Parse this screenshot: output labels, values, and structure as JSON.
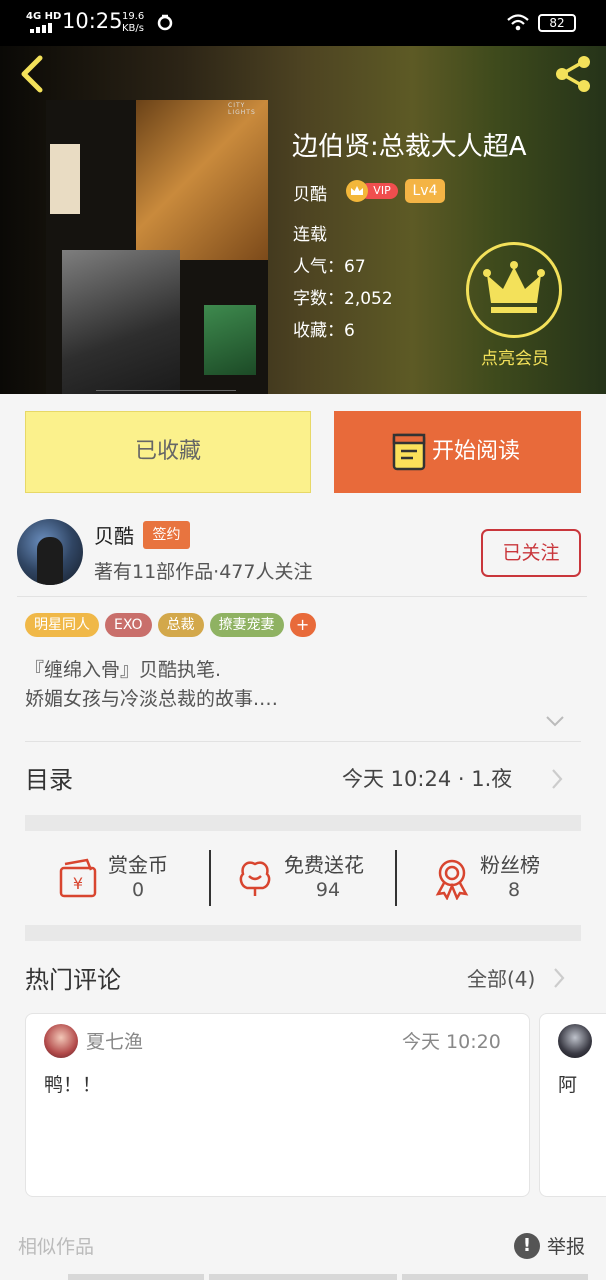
{
  "status_bar": {
    "network": "4G HD",
    "time": "10:25",
    "speed_value": "19.6",
    "speed_unit": "KB/s",
    "battery": "82"
  },
  "header": {
    "book_title": "边伯贤:总裁大人超A",
    "author": "贝酷",
    "vip_label": "VIP",
    "level": "Lv4",
    "status": "连载",
    "popularity": "人气：67",
    "word_count": "字数：2,052",
    "favorites": "收藏：6",
    "vip_cta": "点亮会员",
    "cover_text": "CITY LIGHTS"
  },
  "actions": {
    "favorite_label": "已收藏",
    "read_label": "开始阅读"
  },
  "author_row": {
    "name": "贝酷",
    "signed_badge": "签约",
    "meta": "著有11部作品·477人关注",
    "follow_label": "已关注"
  },
  "tags": [
    {
      "label": "明星同人",
      "color": "#f0b848"
    },
    {
      "label": "EXO",
      "color": "#c96f6b"
    },
    {
      "label": "总裁",
      "color": "#d3a84b"
    },
    {
      "label": "撩妻宠妻",
      "color": "#8fb262"
    }
  ],
  "tag_more": "+",
  "description": {
    "line1": "『缠绵入骨』贝酷执笔.",
    "line2": "娇媚女孩与冷淡总裁的故事.…"
  },
  "toc": {
    "label": "目录",
    "latest": "今天  10:24  ·  1.夜"
  },
  "rewards": [
    {
      "label": "赏金币",
      "value": "0",
      "icon": "coin-voucher-icon"
    },
    {
      "label": "免费送花",
      "value": "94",
      "icon": "flower-icon"
    },
    {
      "label": "粉丝榜",
      "value": "8",
      "icon": "medal-icon"
    }
  ],
  "comments": {
    "title": "热门评论",
    "all_label": "全部(4)",
    "items": [
      {
        "user": "夏七渔",
        "time": "今天  10:20",
        "text": "鸭！！"
      },
      {
        "user": "",
        "time": "",
        "text": "阿"
      }
    ]
  },
  "footer": {
    "similar": "相似作品",
    "report": "举报"
  },
  "colors": {
    "accent_orange": "#e86a3a",
    "favorite_yellow": "#fbf18c",
    "follow_red": "#c9363b",
    "vip_gold": "#f3e15a"
  }
}
